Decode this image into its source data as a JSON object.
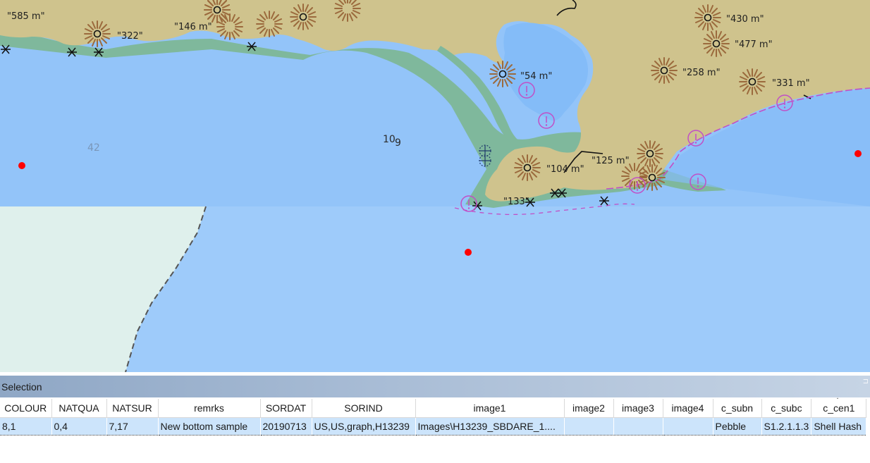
{
  "map": {
    "colors": {
      "sea": "#9ecbfa",
      "deep_sea": "#84bcf8",
      "land": "#cfc38d",
      "intertidal": "#7fb89c",
      "surveyed_area": "#dff0ec",
      "magenta": "#c14fc6",
      "sample_point": "#ff0000"
    },
    "height_labels": [
      "\"585 m\"",
      "\"322\"",
      "\"146 m\"",
      "\"54 m\"",
      "\"430 m\"",
      "\"477 m\"",
      "\"258 m\"",
      "\"331 m\"",
      "\"104 m\"",
      "\"125 m\"",
      "\"133\""
    ],
    "depth_labels": {
      "d42": "42",
      "d10_main": "10",
      "d10_sub": "9"
    },
    "icons": [
      "tree-icon",
      "landmark-circle-icon",
      "rock-icon",
      "caution-icon",
      "sample-point-icon",
      "wreck-icon"
    ]
  },
  "panel": {
    "title": "Selection",
    "pin_glyph": "⊐"
  },
  "table": {
    "columns": [
      "COLOUR",
      "NATQUA",
      "NATSUR",
      "remrks",
      "SORDAT",
      "SORIND",
      "image1",
      "image2",
      "image3",
      "image4",
      "c_subn",
      "c_subc",
      "c_cen1"
    ],
    "rows": [
      {
        "COLOUR": "8,1",
        "NATQUA": "0,4",
        "NATSUR": "7,17",
        "remrks": "New bottom sample",
        "SORDAT": "20190713",
        "SORIND": "US,US,graph,H13239",
        "image1": "Images\\H13239_SBDARE_1....",
        "image2": "",
        "image3": "",
        "image4": "",
        "c_subn": "Pebble",
        "c_subc": "S1.2.1.1.3",
        "c_cen1": "Shell Hash"
      }
    ],
    "sorted_column": "c_cen1"
  }
}
